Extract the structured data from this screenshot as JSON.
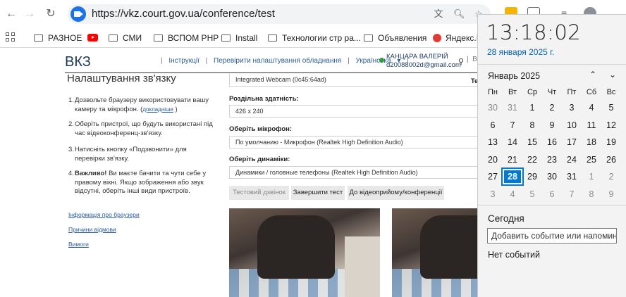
{
  "browser": {
    "url": "https://vkz.court.gov.ua/conference/test",
    "bookmarks": [
      "РАЗНОЕ",
      "СМИ",
      "ВСПОМ PHP",
      "Install",
      "Технологии стр ра...",
      "Объявления",
      "Яндекс.П"
    ]
  },
  "page": {
    "logo": "ВКЗ",
    "nav": {
      "instructions": "Інструкції",
      "check_settings": "Перевірити налаштування обладнання",
      "language": "Українська"
    },
    "user": {
      "name": "КАНЦАРА ВАЛЕРІЙ",
      "email": "d20088002d@gmail.com"
    },
    "section_title": "Налаштування зв'язку",
    "steps": [
      {
        "num": "1.",
        "text": "Дозвольте браузеру використовувати вашу камеру та мікрофон. (",
        "more": "докладніше",
        "tail": " )"
      },
      {
        "num": "2.",
        "text": "Оберіть пристрої, що будуть використані під час відеоконференц-зв'язку."
      },
      {
        "num": "3.",
        "text": "Натисніть кнопку «Подзвонити» для перевірки зв'язку."
      },
      {
        "num": "4.",
        "bold": "Важливо!",
        "text": " Ви маєте бачити та чути себе у правому вікні. Якщо зображення або звук відсутні, оберіть інші види пристроїв."
      }
    ],
    "side_links": [
      "Інформація про браузери",
      "Причини відмови",
      "Вимоги"
    ],
    "camera_value": "Integrated Webcam (0c45:64ad)",
    "resolution_label": "Роздільна здатність:",
    "resolution_value": "426 x 240",
    "mic_label": "Оберіть мікрофон:",
    "mic_value": "По умолчанию - Микрофон (Realtek High Definition Audio)",
    "speaker_label": "Оберіть динаміки:",
    "speaker_value": "Динамики / головные телефоны (Realtek High Definition Audio)",
    "buttons": {
      "test_call": "Тестовий дзвінок",
      "finish_test": "Завершити тест",
      "to_conference": "До відеоприйому/конференції"
    },
    "cut_text": "Те"
  },
  "flyout": {
    "time": "13:18:02",
    "date": "28 января 2025 г.",
    "month": "Январь 2025",
    "weekdays": [
      "Пн",
      "Вт",
      "Ср",
      "Чт",
      "Пт",
      "Сб",
      "Вс"
    ],
    "weeks": [
      [
        "30",
        "31",
        "1",
        "2",
        "3",
        "4",
        "5"
      ],
      [
        "6",
        "7",
        "8",
        "9",
        "10",
        "11",
        "12"
      ],
      [
        "13",
        "14",
        "15",
        "16",
        "17",
        "18",
        "19"
      ],
      [
        "20",
        "21",
        "22",
        "23",
        "24",
        "25",
        "26"
      ],
      [
        "27",
        "28",
        "29",
        "30",
        "31",
        "1",
        "2"
      ],
      [
        "3",
        "4",
        "5",
        "6",
        "7",
        "8",
        "9"
      ]
    ],
    "today_label": "Сегодня",
    "event_placeholder": "Добавить событие или напомина",
    "no_events": "Нет событий"
  }
}
